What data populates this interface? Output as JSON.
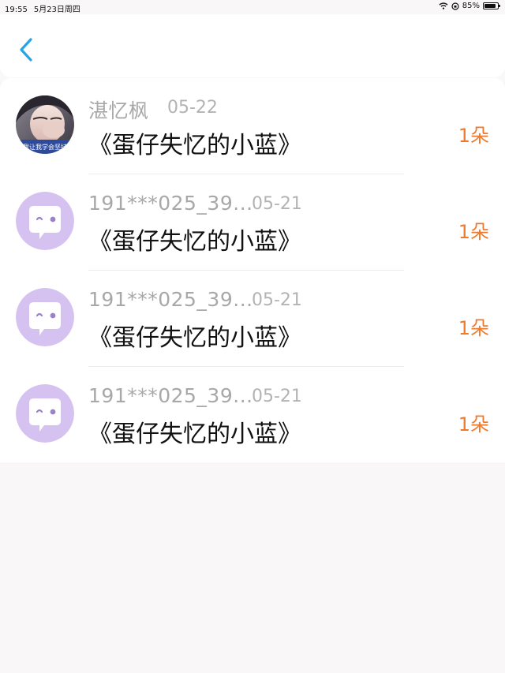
{
  "status_bar": {
    "time": "19:55",
    "date": "5月23日周四",
    "battery_percent": "85%",
    "battery_level": 0.85
  },
  "nav": {
    "back_icon": "chevron-left-icon"
  },
  "colors": {
    "accent_back": "#29a3e8",
    "count_color": "#f07a2c",
    "avatar_purple": "#d6c2f0"
  },
  "avatar_banner_text": "我让我学会坚持",
  "records": [
    {
      "name": "湛忆枫",
      "date": "05-22",
      "title": "《蛋仔失忆的小蓝》",
      "count": "1朵",
      "avatar": "photo"
    },
    {
      "name": "191***025_39...",
      "date": "05-21",
      "title": "《蛋仔失忆的小蓝》",
      "count": "1朵",
      "avatar": "default-chat-icon"
    },
    {
      "name": "191***025_39...",
      "date": "05-21",
      "title": "《蛋仔失忆的小蓝》",
      "count": "1朵",
      "avatar": "default-chat-icon"
    },
    {
      "name": "191***025_39...",
      "date": "05-21",
      "title": "《蛋仔失忆的小蓝》",
      "count": "1朵",
      "avatar": "default-chat-icon"
    }
  ]
}
